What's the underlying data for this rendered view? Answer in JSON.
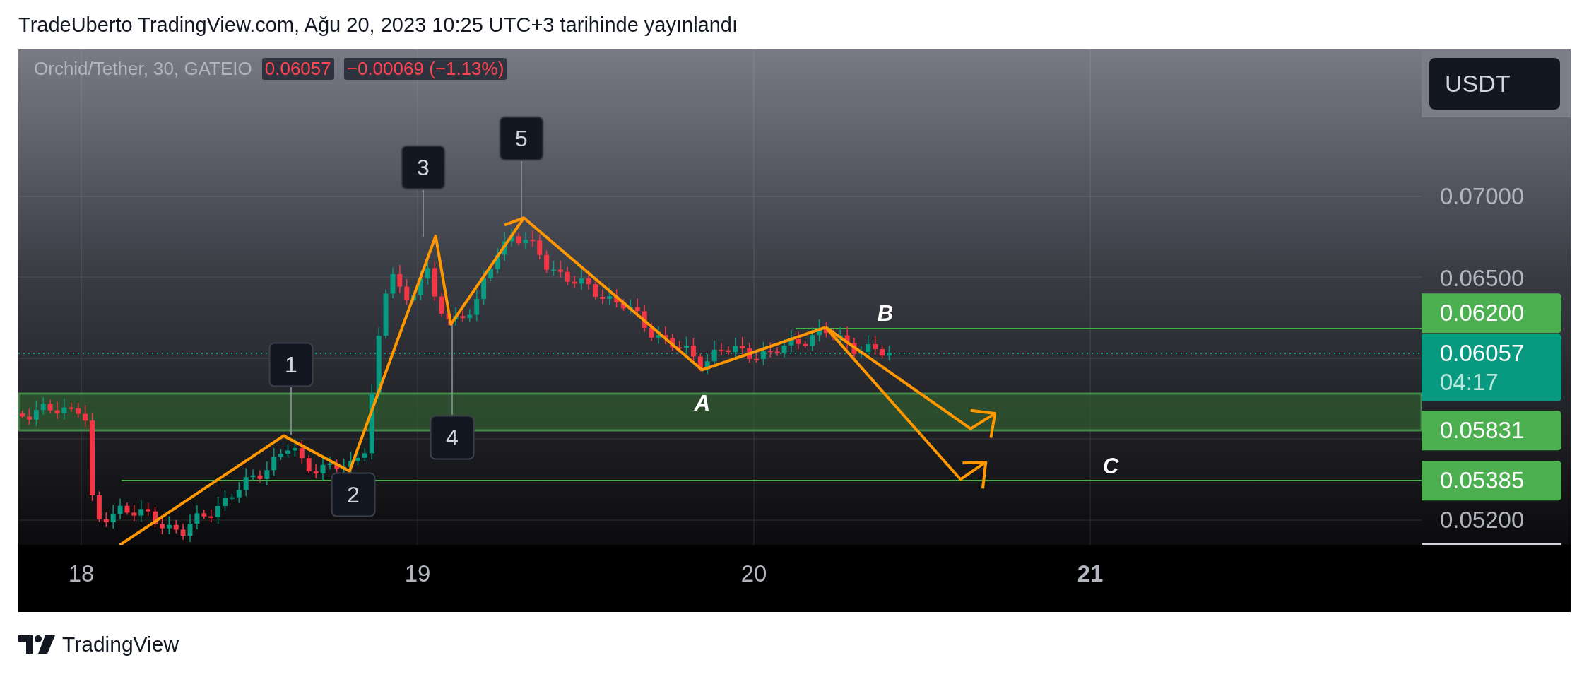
{
  "header": {
    "text": "TradeUberto TradingView.com, Ağu 20, 2023 10:25 UTC+3 tarihinde yayınlandı"
  },
  "legend": {
    "symbol": "Orchid/Tether, 30, GATEIO",
    "price": "0.06057",
    "change": "−0.00069 (−1.13%)"
  },
  "currency": "USDT",
  "price_axis": [
    {
      "kind": "tick",
      "text": "0.07000"
    },
    {
      "kind": "tick",
      "text": "0.06500"
    },
    {
      "kind": "level",
      "text": "0.06200"
    },
    {
      "kind": "current",
      "text": "0.06057",
      "countdown": "04:17"
    },
    {
      "kind": "level",
      "text": "0.05831"
    },
    {
      "kind": "level",
      "text": "0.05385"
    },
    {
      "kind": "tick",
      "text": "0.05200"
    }
  ],
  "time_axis": [
    {
      "text": "18",
      "bold": false
    },
    {
      "text": "19",
      "bold": false
    },
    {
      "text": "20",
      "bold": false
    },
    {
      "text": "21",
      "bold": true
    }
  ],
  "wave_labels": [
    {
      "kind": "box",
      "text": "1"
    },
    {
      "kind": "box",
      "text": "2"
    },
    {
      "kind": "box",
      "text": "3"
    },
    {
      "kind": "box",
      "text": "4"
    },
    {
      "kind": "box",
      "text": "5"
    },
    {
      "kind": "letter",
      "text": "A"
    },
    {
      "kind": "letter",
      "text": "B"
    },
    {
      "kind": "letter",
      "text": "C"
    }
  ],
  "footer": {
    "brand": "TradingView"
  }
}
